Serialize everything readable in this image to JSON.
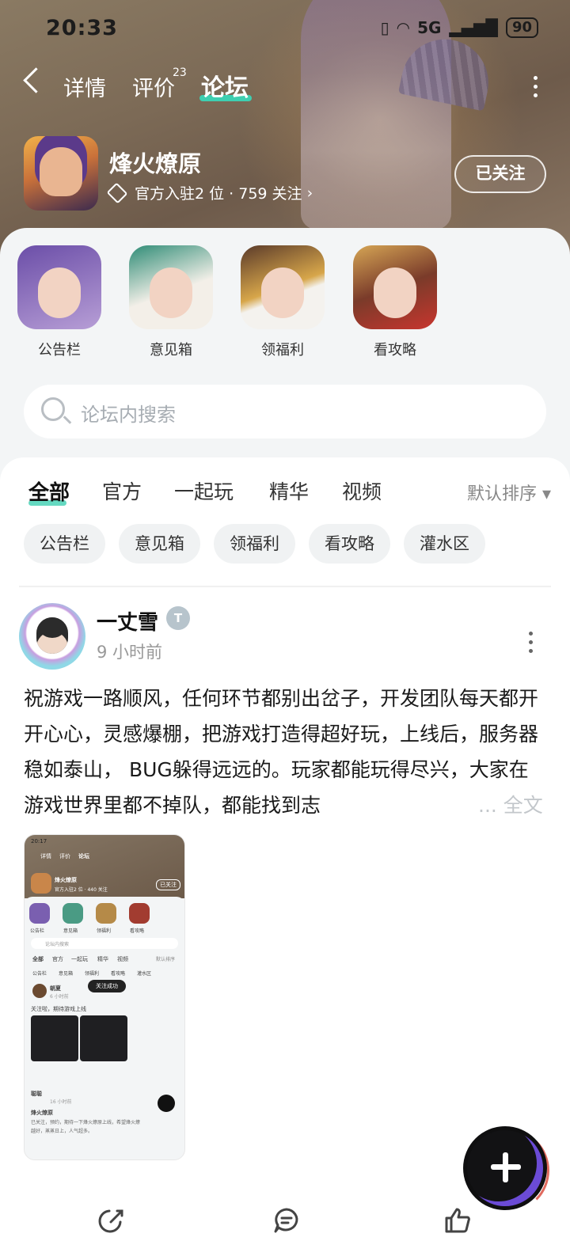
{
  "status_bar": {
    "time": "20:33",
    "network": "5G",
    "battery": "90"
  },
  "nav": {
    "tabs": [
      {
        "label": "详情"
      },
      {
        "label": "评价",
        "badge": "23"
      },
      {
        "label": "论坛"
      }
    ],
    "active_tab": "论坛"
  },
  "game": {
    "name": "烽火燎原",
    "meta": "官方入驻2 位 · 759 关注",
    "follow_label": "已关注"
  },
  "categories": [
    {
      "label": "公告栏"
    },
    {
      "label": "意见箱"
    },
    {
      "label": "领福利"
    },
    {
      "label": "看攻略"
    }
  ],
  "search": {
    "placeholder": "论坛内搜索"
  },
  "feed_tabs": [
    {
      "label": "全部"
    },
    {
      "label": "官方"
    },
    {
      "label": "一起玩"
    },
    {
      "label": "精华"
    },
    {
      "label": "视频"
    }
  ],
  "sort_label": "默认排序",
  "chips": [
    {
      "label": "公告栏"
    },
    {
      "label": "意见箱"
    },
    {
      "label": "领福利"
    },
    {
      "label": "看攻略"
    },
    {
      "label": "灌水区"
    }
  ],
  "post": {
    "user": "一丈雪",
    "time": "9 小时前",
    "body": "祝游戏一路顺风，任何环节都别出岔子，开发团队每天都开开心心，灵感爆棚，把游戏打造得超好玩，上线后，服务器稳如泰山， BUG躲得远远的。玩家都能玩得尽兴，大家在游戏世界里都不掉队，都能找到志",
    "read_more": "... 全文"
  },
  "screenshot": {
    "time": "20:17",
    "tabs": [
      "详情",
      "评价",
      "论坛"
    ],
    "game_name": "烽火燎原",
    "meta": "官方入驻2 位 · 440 关注",
    "follow": "已关注",
    "categories": [
      "公告栏",
      "意见箱",
      "领福利",
      "看攻略"
    ],
    "search": "论坛内搜索",
    "feed_tabs": [
      "全部",
      "官方",
      "一起玩",
      "精华",
      "视频"
    ],
    "sort": "默认排序",
    "chips": [
      "公告栏",
      "意见箱",
      "领福利",
      "看攻略",
      "灌水区"
    ],
    "post1_user": "朝夏",
    "post1_time": "6 小时前",
    "post1_text": "关注啦，期待游戏上线",
    "toast": "关注成功",
    "post2_user": "聪聪",
    "post2_time": "16 小时前",
    "post2_title": "烽火燎原",
    "post2_text1": "已关注，预约，期待一下烽火燎原上线，希望烽火燎",
    "post2_text2": "越好，蒸蒸日上，人气超多。"
  }
}
